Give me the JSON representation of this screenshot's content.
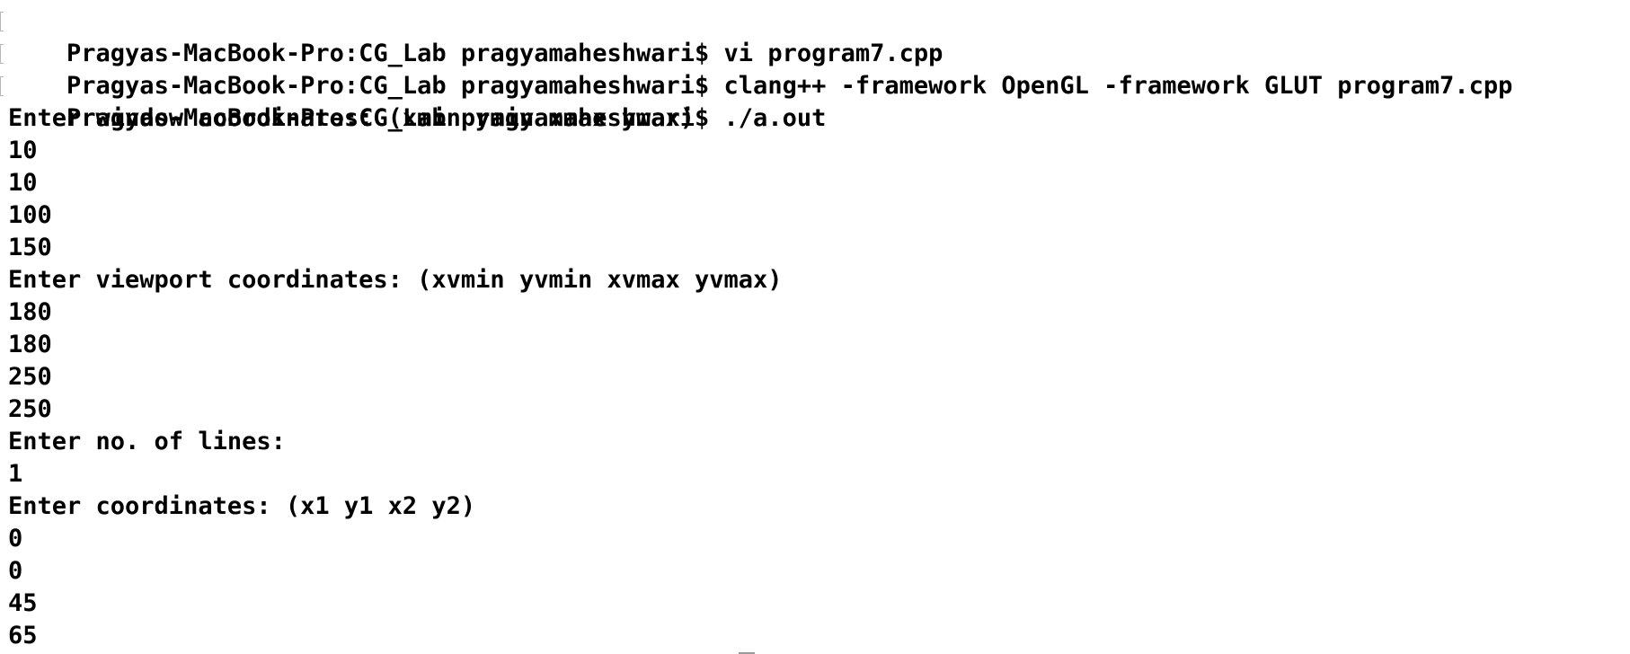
{
  "terminal": {
    "commands": [
      {
        "prompt": "Pragyas-MacBook-Pro:CG_Lab pragyamaheshwari$",
        "command": "vi program7.cpp"
      },
      {
        "prompt": "Pragyas-MacBook-Pro:CG_Lab pragyamaheshwari$",
        "command": "clang++ -framework OpenGL -framework GLUT program7.cpp"
      },
      {
        "prompt": "Pragyas-MacBook-Pro:CG_Lab pragyamaheshwari$",
        "command": "./a.out"
      }
    ],
    "output": [
      "Enter window coordinates: (xmin ymin xmax ymax)",
      "10",
      "10",
      "100",
      "150",
      "Enter viewport coordinates: (xvmin yvmin xvmax yvmax)",
      "180",
      "180",
      "250",
      "250",
      "Enter no. of lines:",
      "1",
      "Enter coordinates: (x1 y1 x2 y2)",
      "0",
      "0",
      "45",
      "65"
    ]
  }
}
